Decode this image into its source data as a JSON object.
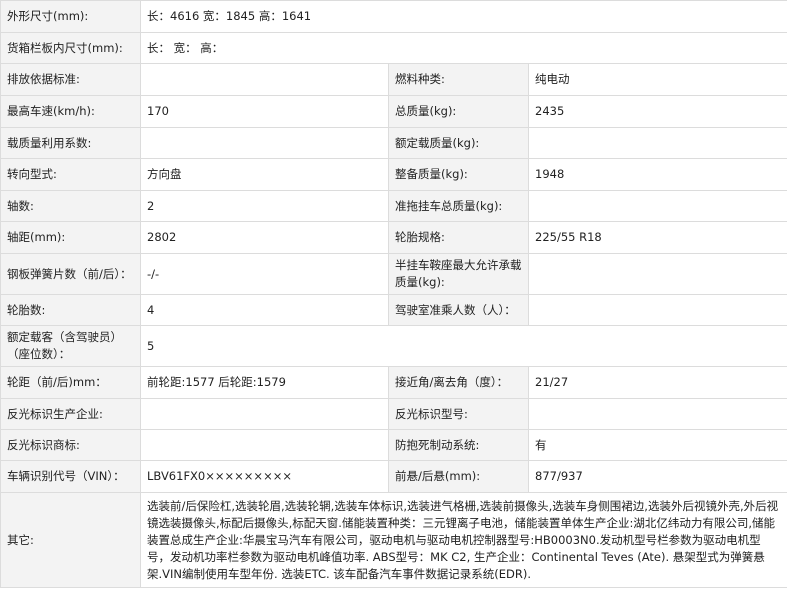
{
  "rows": [
    {
      "l1": "外形尺寸(mm):",
      "v1": "长：4616 宽：1845 高：1641"
    },
    {
      "l1": "货箱栏板内尺寸(mm):",
      "v1": "长： 宽： 高："
    },
    {
      "l1": "排放依据标准:",
      "v1": "",
      "l2": "燃料种类:",
      "v2": "纯电动"
    },
    {
      "l1": "最高车速(km/h):",
      "v1": "170",
      "l2": "总质量(kg):",
      "v2": "2435"
    },
    {
      "l1": "载质量利用系数:",
      "v1": "",
      "l2": "额定载质量(kg):",
      "v2": ""
    },
    {
      "l1": "转向型式:",
      "v1": "方向盘",
      "l2": "整备质量(kg):",
      "v2": "1948"
    },
    {
      "l1": "轴数:",
      "v1": "2",
      "l2": "准拖挂车总质量(kg):",
      "v2": ""
    },
    {
      "l1": "轴距(mm):",
      "v1": "2802",
      "l2": "轮胎规格:",
      "v2": "225/55 R18"
    },
    {
      "l1": "钢板弹簧片数（前/后）：",
      "v1": "-/-",
      "l2": "半挂车鞍座最大允许承载质量(kg):",
      "v2": ""
    },
    {
      "l1": "轮胎数:",
      "v1": "4",
      "l2": "驾驶室准乘人数（人）：",
      "v2": ""
    },
    {
      "l1": "额定载客（含驾驶员）（座位数）：",
      "v1": "5"
    },
    {
      "l1": "轮距（前/后)mm：",
      "v1": "前轮距:1577 后轮距:1579",
      "l2": "接近角/离去角（度）：",
      "v2": "21/27"
    },
    {
      "l1": "反光标识生产企业:",
      "v1": "",
      "l2": "反光标识型号:",
      "v2": ""
    },
    {
      "l1": "反光标识商标:",
      "v1": "",
      "l2": "防抱死制动系统:",
      "v2": "有"
    },
    {
      "l1": "车辆识别代号（VIN）：",
      "v1": "LBV61FX0×××××××××",
      "l2": "前悬/后悬(mm):",
      "v2": "877/937"
    }
  ],
  "other": {
    "label": "其它:",
    "text": "选装前/后保险杠,选装轮眉,选装轮辋,选装车体标识,选装进气格栅,选装前摄像头,选装车身侧围裙边,选装外后视镜外壳,外后视镜选装摄像头,标配后摄像头,标配天窗.储能装置种类：三元锂离子电池，储能装置单体生产企业:湖北亿纬动力有限公司,储能装置总成生产企业:华晨宝马汽车有限公司，驱动电机与驱动电机控制器型号:HB0003N0.发动机型号栏参数为驱动电机型号，发动机功率栏参数为驱动电机峰值功率. ABS型号：MK C2, 生产企业：Continental Teves (Ate). 悬架型式为弹簧悬架.VIN编制使用车型年份. 选装ETC. 该车配备汽车事件数据记录系统(EDR)."
  }
}
